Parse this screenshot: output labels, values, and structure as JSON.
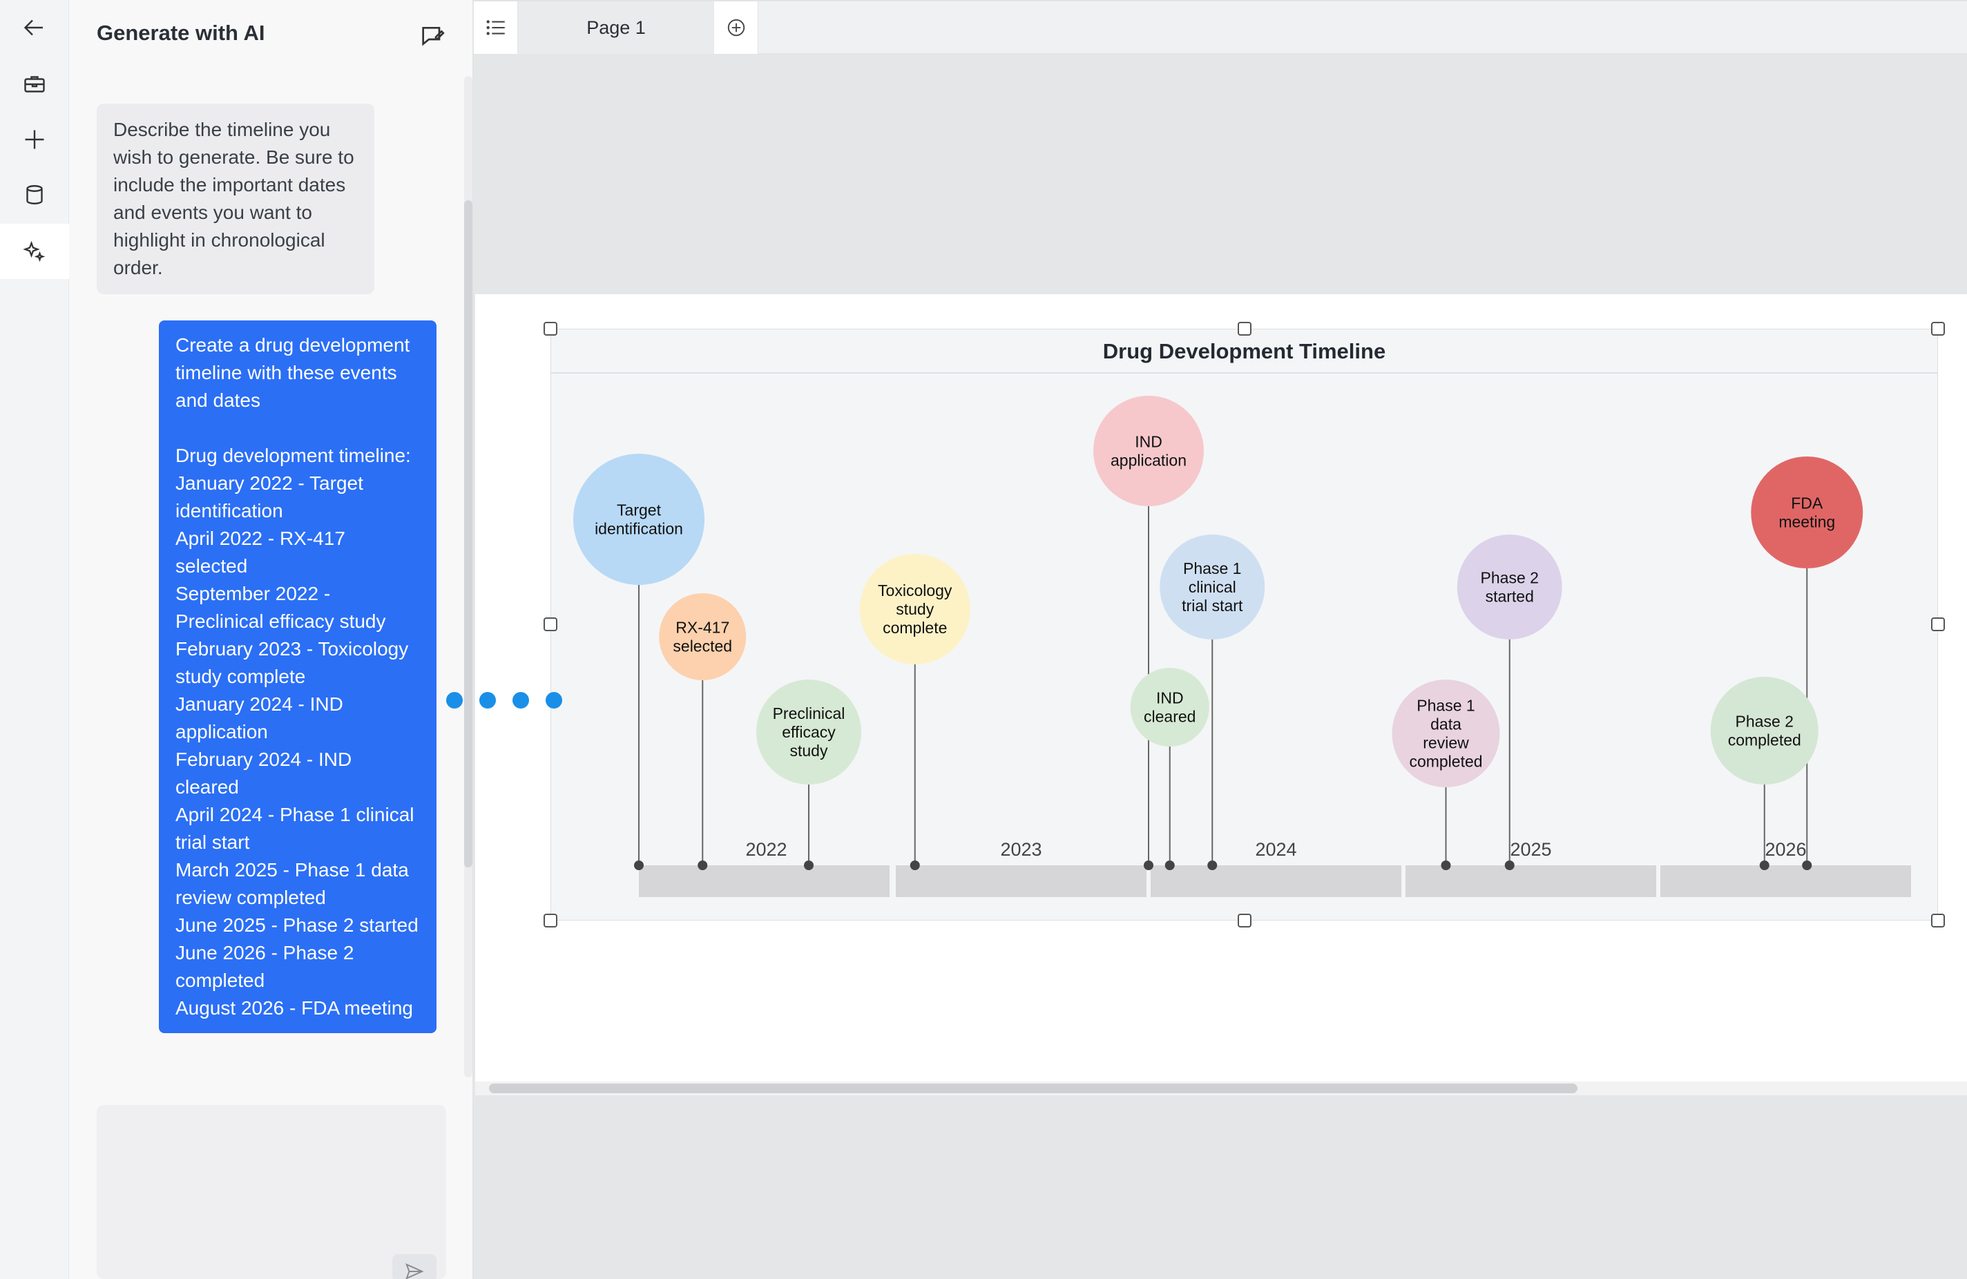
{
  "rail": {
    "items": [
      {
        "icon": "arrow-left-icon",
        "active": false
      },
      {
        "icon": "briefcase-icon",
        "active": false
      },
      {
        "icon": "plus-icon",
        "active": false
      },
      {
        "icon": "database-icon",
        "active": false
      },
      {
        "icon": "sparkle-icon",
        "active": true
      }
    ]
  },
  "panel": {
    "title": "Generate with AI",
    "system_message": "Describe the timeline you wish to generate. Be sure to include the important dates and events you want to highlight in chronological order.",
    "user_message": "Create a drug development timeline with these events and dates\n\nDrug development timeline:\nJanuary 2022 - Target identification\nApril 2022 - RX-417 selected\nSeptember 2022 - Preclinical efficacy study\nFebruary 2023 - Toxicology study complete\nJanuary 2024 - IND application\nFebruary 2024 - IND cleared\nApril 2024 - Phase 1 clinical trial start\nMarch 2025 - Phase 1 data review completed\nJune 2025 - Phase 2 started\nJune 2026 - Phase 2 completed\nAugust 2026 - FDA meeting",
    "input_placeholder": ""
  },
  "toolbar": {
    "page_tab": "Page 1"
  },
  "timeline": {
    "title": "Drug Development Timeline",
    "years": [
      "2022",
      "2023",
      "2024",
      "2025",
      "2026"
    ],
    "events": [
      {
        "label": "Target identification",
        "lines": [
          "Target",
          "identification"
        ],
        "date": "2022-01",
        "color": "#b7d9f6"
      },
      {
        "label": "RX-417 selected",
        "lines": [
          "RX-417",
          "selected"
        ],
        "date": "2022-04",
        "color": "#fdd1ad"
      },
      {
        "label": "Preclinical efficacy study",
        "lines": [
          "Preclinical",
          "efficacy",
          "study"
        ],
        "date": "2022-09",
        "color": "#d6e9d4"
      },
      {
        "label": "Toxicology study complete",
        "lines": [
          "Toxicology",
          "study",
          "complete"
        ],
        "date": "2023-02",
        "color": "#fdf2c6"
      },
      {
        "label": "IND application",
        "lines": [
          "IND",
          "application"
        ],
        "date": "2024-01",
        "color": "#f6c8cb"
      },
      {
        "label": "IND cleared",
        "lines": [
          "IND",
          "cleared"
        ],
        "date": "2024-02",
        "color": "#d6e9d4"
      },
      {
        "label": "Phase 1 clinical trial start",
        "lines": [
          "Phase 1",
          "clinical",
          "trial start"
        ],
        "date": "2024-04",
        "color": "#cfdff2"
      },
      {
        "label": "Phase 1 data review completed",
        "lines": [
          "Phase 1",
          "data",
          "review",
          "completed"
        ],
        "date": "2025-03",
        "color": "#e8d3de"
      },
      {
        "label": "Phase 2 started",
        "lines": [
          "Phase 2",
          "started"
        ],
        "date": "2025-06",
        "color": "#dcd3ea"
      },
      {
        "label": "Phase 2 completed",
        "lines": [
          "Phase 2",
          "completed"
        ],
        "date": "2026-06",
        "color": "#d4e6d4"
      },
      {
        "label": "FDA meeting",
        "lines": [
          "FDA",
          "meeting"
        ],
        "date": "2026-08",
        "color": "#e06666"
      }
    ]
  }
}
